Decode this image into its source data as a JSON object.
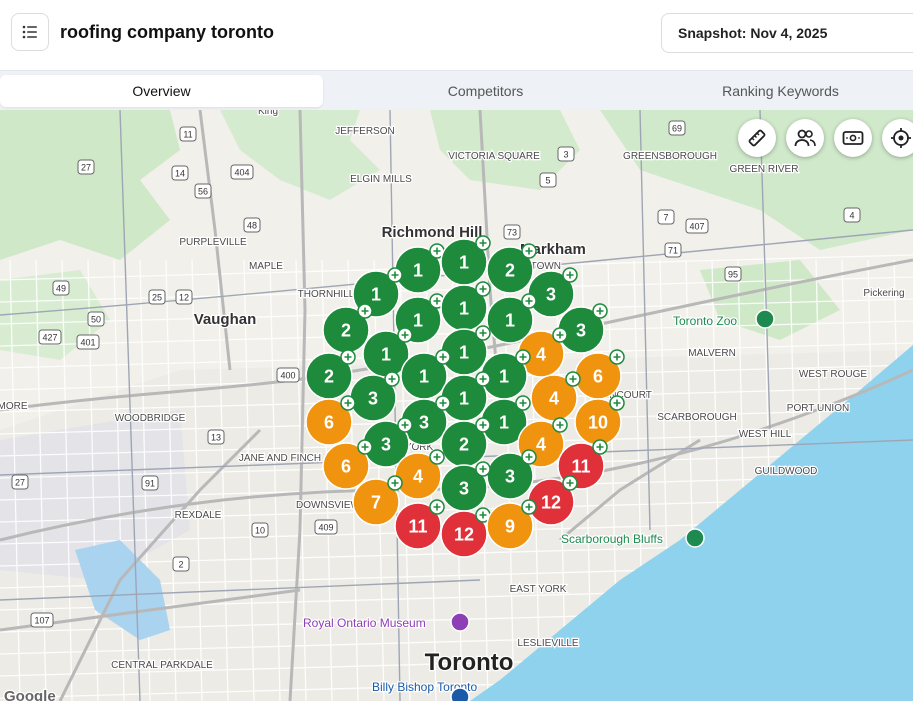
{
  "header": {
    "title": "roofing company toronto",
    "snapshot_label": "Snapshot: Nov 4, 2025"
  },
  "tabs": [
    {
      "label": "Overview",
      "active": true
    },
    {
      "label": "Competitors",
      "active": false
    },
    {
      "label": "Ranking Keywords",
      "active": false
    }
  ],
  "colors": {
    "green": "#1e8a3c",
    "orange": "#f0930f",
    "red": "#e0303a",
    "water": "#8fd2ee",
    "park": "#c8e6c2"
  },
  "map_controls": [
    {
      "name": "ruler-icon"
    },
    {
      "name": "people-icon"
    },
    {
      "name": "money-icon"
    },
    {
      "name": "locate-icon"
    }
  ],
  "map_labels": {
    "large": [
      "Toronto"
    ],
    "city": [
      "Richmond Hill",
      "Vaughan",
      "Markham"
    ],
    "areas": [
      "JEFFERSON",
      "ELGIN MILLS",
      "VICTORIA SQUARE",
      "GREENSBOROUGH",
      "GREEN RIVER",
      "PURPLEVILLE",
      "MAPLE",
      "THORNHILL",
      "DOWNTOWN",
      "WOODBRIDGE",
      "JANE AND FINCH",
      "DOWNSVIEW",
      "REXDALE",
      "MALVERN",
      "WEST ROUGE",
      "PORT UNION",
      "SCARBOROUGH",
      "WEST HILL",
      "GUILDWOOD",
      "EAST YORK",
      "LESLIEVILLE",
      "CENTRAL PARKDALE",
      "STLEMORE",
      "NORTH YORK",
      "AGINCOURT",
      "King",
      "Pickering"
    ],
    "pois": [
      "Toronto Zoo",
      "Scarborough Bluffs",
      "Royal Ontario Museum",
      "Billy Bishop Toronto"
    ],
    "google": "Google",
    "shields": [
      "11",
      "27",
      "14",
      "56",
      "69",
      "3",
      "5",
      "404",
      "48",
      "73",
      "7",
      "407",
      "71",
      "4",
      "95",
      "25",
      "12",
      "49",
      "50",
      "427",
      "401",
      "409",
      "2",
      "10",
      "400",
      "13",
      "107",
      "91",
      "27"
    ]
  },
  "markers": [
    {
      "rank": "1",
      "color": "green"
    },
    {
      "rank": "1",
      "color": "green"
    },
    {
      "rank": "2",
      "color": "green"
    },
    {
      "rank": "1",
      "color": "green"
    },
    {
      "rank": "3",
      "color": "green"
    },
    {
      "rank": "2",
      "color": "green"
    },
    {
      "rank": "1",
      "color": "green"
    },
    {
      "rank": "1",
      "color": "green"
    },
    {
      "rank": "1",
      "color": "green"
    },
    {
      "rank": "3",
      "color": "green"
    },
    {
      "rank": "1",
      "color": "green"
    },
    {
      "rank": "1",
      "color": "green"
    },
    {
      "rank": "4",
      "color": "orange"
    },
    {
      "rank": "2",
      "color": "green"
    },
    {
      "rank": "1",
      "color": "green"
    },
    {
      "rank": "1",
      "color": "green"
    },
    {
      "rank": "6",
      "color": "orange"
    },
    {
      "rank": "3",
      "color": "green"
    },
    {
      "rank": "1",
      "color": "green"
    },
    {
      "rank": "4",
      "color": "orange"
    },
    {
      "rank": "6",
      "color": "orange"
    },
    {
      "rank": "3",
      "color": "green"
    },
    {
      "rank": "1",
      "color": "green"
    },
    {
      "rank": "10",
      "color": "orange"
    },
    {
      "rank": "3",
      "color": "green"
    },
    {
      "rank": "2",
      "color": "green"
    },
    {
      "rank": "4",
      "color": "orange"
    },
    {
      "rank": "6",
      "color": "orange"
    },
    {
      "rank": "4",
      "color": "orange"
    },
    {
      "rank": "3",
      "color": "green"
    },
    {
      "rank": "11",
      "color": "red"
    },
    {
      "rank": "7",
      "color": "orange"
    },
    {
      "rank": "3",
      "color": "green"
    },
    {
      "rank": "12",
      "color": "red"
    },
    {
      "rank": "11",
      "color": "red"
    },
    {
      "rank": "12",
      "color": "red"
    },
    {
      "rank": "9",
      "color": "orange"
    }
  ]
}
